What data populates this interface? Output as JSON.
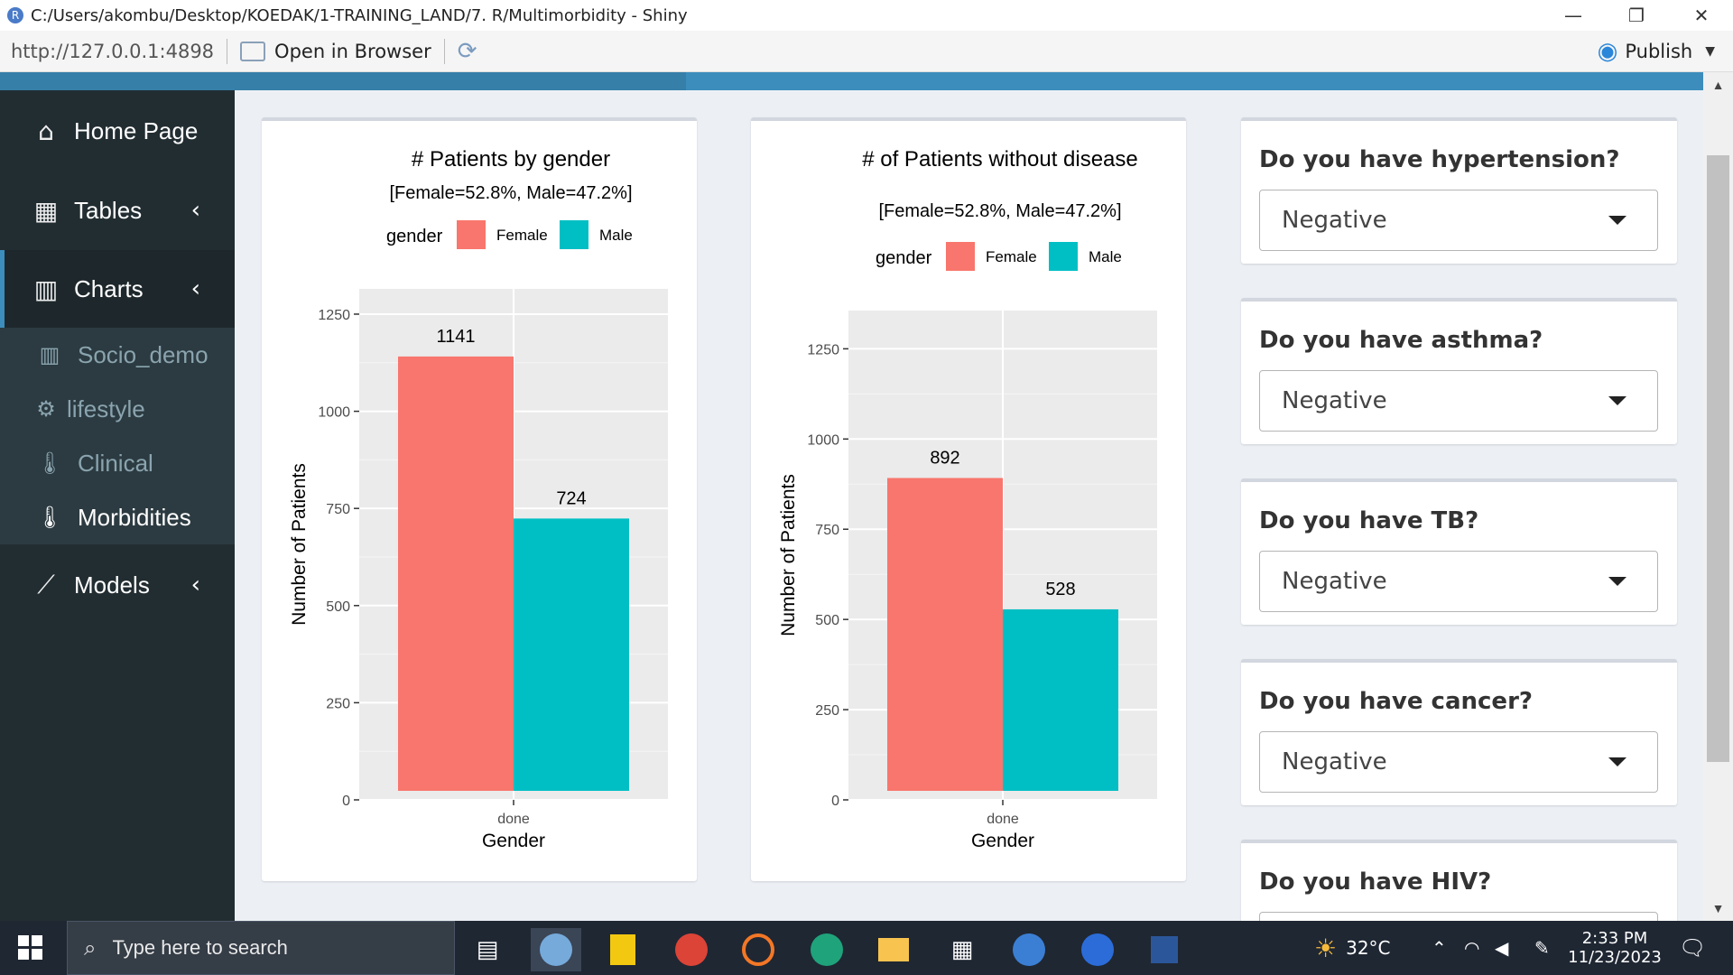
{
  "window": {
    "app_icon": "R",
    "title": "C:/Users/akombu/Desktop/KOEDAK/1-TRAINING_LAND/7. R/Multimorbidity - Shiny",
    "minimize": "—",
    "maximize": "❐",
    "close": "✕"
  },
  "toolbar": {
    "url": "http://127.0.0.1:4898",
    "open_in_browser": "Open in Browser",
    "publish": "Publish"
  },
  "sidebar": {
    "items": [
      {
        "label": "Home Page",
        "icon": "home-icon"
      },
      {
        "label": "Tables",
        "icon": "table-icon"
      },
      {
        "label": "Charts",
        "icon": "bar-chart-icon"
      },
      {
        "label": "Models",
        "icon": "line-chart-icon"
      }
    ],
    "sub_items": [
      {
        "label": "Socio_demo",
        "icon": "bar-chart-icon"
      },
      {
        "label": "lifestyle",
        "icon": "gear-icon"
      },
      {
        "label": "Clinical",
        "icon": "thermometer-icon"
      },
      {
        "label": "Morbidities",
        "icon": "thermometer-icon"
      }
    ]
  },
  "questions": [
    {
      "label": "Do you have hypertension?",
      "value": "Negative"
    },
    {
      "label": "Do you have asthma?",
      "value": "Negative"
    },
    {
      "label": "Do you have TB?",
      "value": "Negative"
    },
    {
      "label": "Do you have cancer?",
      "value": "Negative"
    },
    {
      "label": "Do you have HIV?",
      "value": ""
    }
  ],
  "colors": {
    "female": "#F8766D",
    "male": "#00BFC4",
    "panel": "#EBEBEB",
    "sidebar": "#222d32",
    "header": "#3c8dbc"
  },
  "chart_data": [
    {
      "type": "bar",
      "title": "# Patients by gender",
      "subtitle": "[Female=52.8%, Male=47.2%]",
      "legend_title": "gender",
      "legend_position": "top",
      "categories": [
        "done"
      ],
      "series": [
        {
          "name": "Female",
          "values": [
            1141
          ]
        },
        {
          "name": "Male",
          "values": [
            724
          ]
        }
      ],
      "data_labels": [
        "1141",
        "724"
      ],
      "xlabel": "Gender",
      "ylabel": "Number of Patients",
      "ylim": [
        0,
        1300
      ],
      "yticks": [
        0,
        250,
        500,
        750,
        1000,
        1250
      ],
      "grid": true
    },
    {
      "type": "bar",
      "title": "# of Patients without disease",
      "subtitle": "[Female=52.8%, Male=47.2%]",
      "legend_title": "gender",
      "legend_position": "top",
      "categories": [
        "done"
      ],
      "series": [
        {
          "name": "Female",
          "values": [
            892
          ]
        },
        {
          "name": "Male",
          "values": [
            528
          ]
        }
      ],
      "data_labels": [
        "892",
        "528"
      ],
      "xlabel": "Gender",
      "ylabel": "Number of Patients",
      "ylim": [
        0,
        1250
      ],
      "yticks": [
        0,
        250,
        500,
        750,
        1000,
        1250
      ],
      "grid": true
    }
  ],
  "taskbar": {
    "search_placeholder": "Type here to search",
    "temperature": "32°C",
    "time": "2:33 PM",
    "date": "11/23/2023"
  }
}
